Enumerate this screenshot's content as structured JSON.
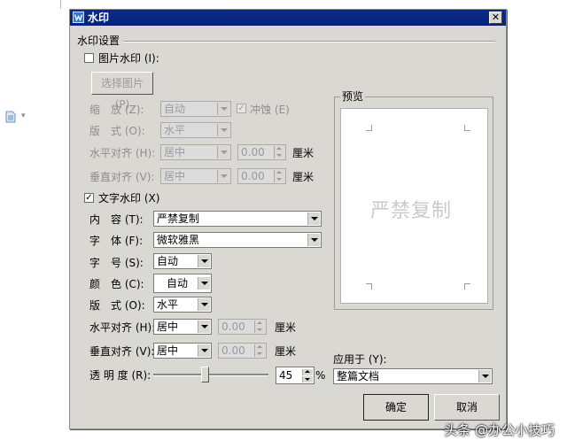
{
  "dialog": {
    "title": "水印",
    "close": "✕",
    "group_title": "水印设置",
    "preview_title": "预览"
  },
  "picture_watermark": {
    "checkbox_label": "图片水印 (I):",
    "checked": false,
    "select_button": "选择图片 (P)",
    "scale_label": "缩　放 (Z):",
    "scale_value": "自动",
    "washout_label": "冲蚀 (E)",
    "washout_checked": true,
    "layout_label": "版　式 (O):",
    "layout_value": "水平",
    "halign_label": "水平对齐 (H):",
    "halign_value": "居中",
    "halign_offset": "0.00",
    "valign_label": "垂直对齐 (V):",
    "valign_value": "居中",
    "valign_offset": "0.00",
    "unit": "厘米"
  },
  "text_watermark": {
    "checkbox_label": "文字水印 (X)",
    "checked": true,
    "content_label": "内　容 (T):",
    "content_value": "严禁复制",
    "font_label": "字　体 (F):",
    "font_value": "微软雅黑",
    "size_label": "字　号 (S):",
    "size_value": "自动",
    "color_label": "颜　色 (C):",
    "color_value": "自动",
    "layout_label": "版　式 (O):",
    "layout_value": "水平",
    "halign_label": "水平对齐 (H):",
    "halign_value": "居中",
    "halign_offset": "0.00",
    "valign_label": "垂直对齐 (V):",
    "valign_value": "居中",
    "valign_offset": "0.00",
    "unit": "厘米",
    "transparency_label": "透 明 度 (R):",
    "transparency_value": "45",
    "transparency_unit": "%",
    "transparency_fraction": 0.45
  },
  "preview": {
    "watermark_text": "严禁复制"
  },
  "apply_to": {
    "label": "应用于 (Y):",
    "value": "整篇文档"
  },
  "buttons": {
    "ok": "确定",
    "cancel": "取消"
  },
  "credit": "头条 @办公小技巧",
  "colors": {
    "titlebar": "#0c2a8c",
    "dialog_bg": "#d9d8d3",
    "preview_text": "#c9c9c9"
  }
}
